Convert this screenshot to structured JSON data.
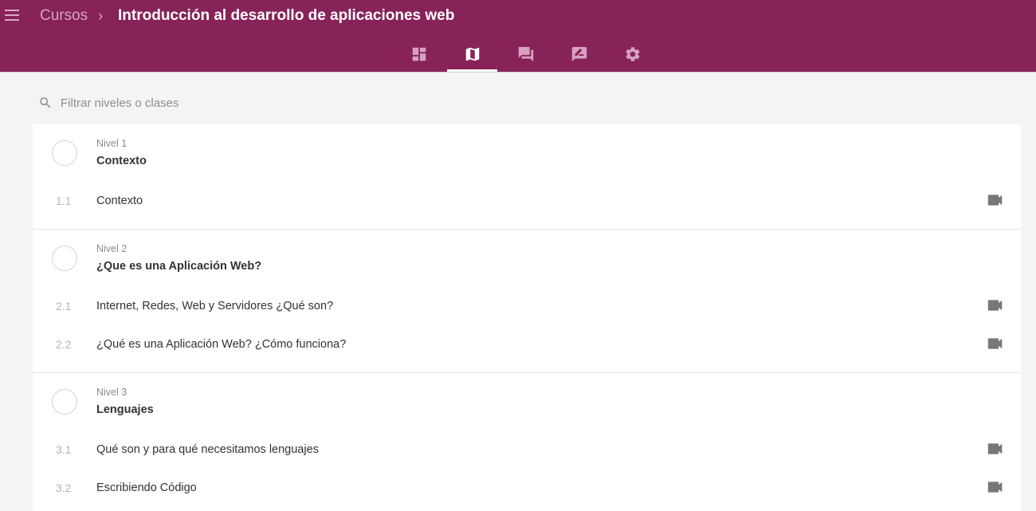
{
  "header": {
    "breadcrumb_parent": "Cursos",
    "breadcrumb_separator": "›",
    "course_title": "Introducción al desarrollo de aplicaciones web"
  },
  "tabs": [
    {
      "icon": "dashboard-icon",
      "active": false
    },
    {
      "icon": "map-icon",
      "active": true
    },
    {
      "icon": "forum-icon",
      "active": false
    },
    {
      "icon": "rate-review-icon",
      "active": false
    },
    {
      "icon": "gear-icon",
      "active": false
    }
  ],
  "search": {
    "placeholder": "Filtrar niveles o clases"
  },
  "levels": [
    {
      "label": "Nivel 1",
      "name": "Contexto",
      "lessons": [
        {
          "num": "1.1",
          "title": "Contexto",
          "icon": "video-camera-icon"
        }
      ]
    },
    {
      "label": "Nivel 2",
      "name": "¿Que es una Aplicación Web?",
      "lessons": [
        {
          "num": "2.1",
          "title": "Internet, Redes, Web y Servidores ¿Qué son?",
          "icon": "video-camera-icon"
        },
        {
          "num": "2.2",
          "title": "¿Qué es una Aplicación Web? ¿Cómo funciona?",
          "icon": "video-camera-icon"
        }
      ]
    },
    {
      "label": "Nivel 3",
      "name": "Lenguajes",
      "lessons": [
        {
          "num": "3.1",
          "title": "Qué son y para qué necesitamos lenguajes",
          "icon": "video-camera-icon"
        },
        {
          "num": "3.2",
          "title": "Escribiendo Código",
          "icon": "video-camera-icon"
        }
      ]
    }
  ],
  "colors": {
    "header_bg": "#872359",
    "muted_header_text": "#d7a2c0",
    "page_bg": "#f4f4f4"
  }
}
